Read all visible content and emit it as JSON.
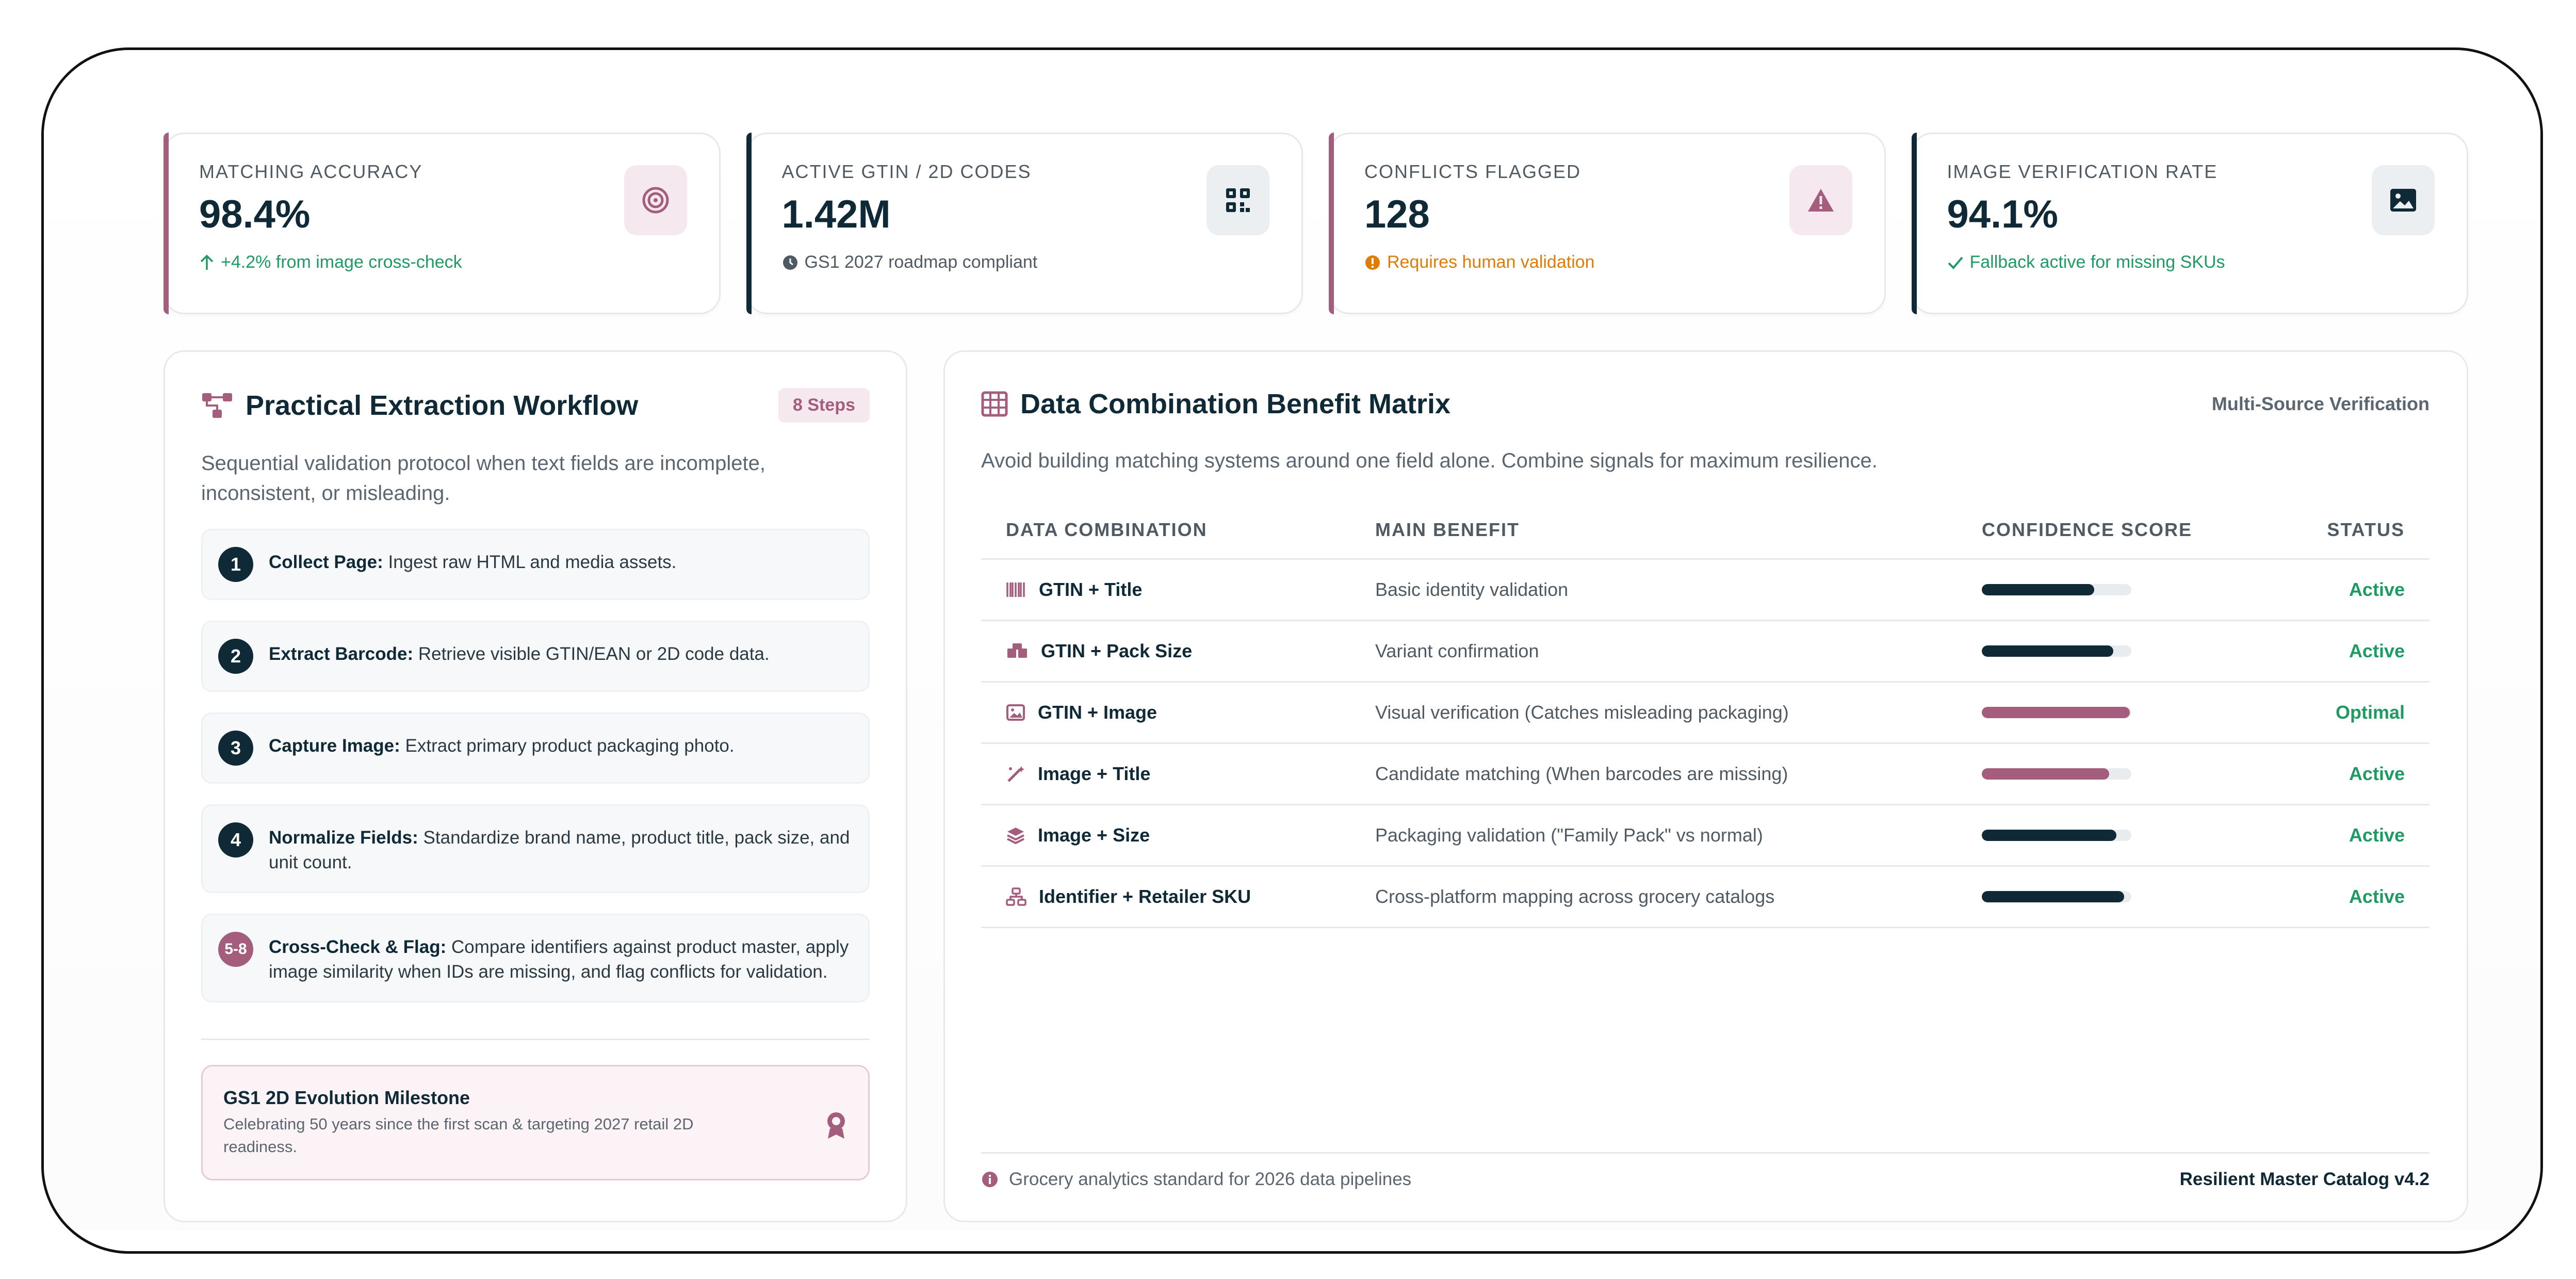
{
  "kpis": [
    {
      "label": "MATCHING ACCURACY",
      "value": "98.4%",
      "sub": "+4.2% from image cross-check",
      "sub_icon": "arrow-up-icon",
      "icon": "target-icon",
      "accent": "#a45d7c"
    },
    {
      "label": "ACTIVE GTIN / 2D CODES",
      "value": "1.42M",
      "sub": "GS1 2027 roadmap compliant",
      "sub_icon": "clock-icon",
      "icon": "qr-code-icon",
      "accent": "#0f2a36"
    },
    {
      "label": "CONFLICTS FLAGGED",
      "value": "128",
      "sub": "Requires human validation",
      "sub_icon": "alert-circle-icon",
      "icon": "warning-triangle-icon",
      "accent": "#a45d7c"
    },
    {
      "label": "IMAGE VERIFICATION RATE",
      "value": "94.1%",
      "sub": "Fallback active for missing SKUs",
      "sub_icon": "check-icon",
      "icon": "image-icon",
      "accent": "#0f2a36"
    }
  ],
  "workflow": {
    "title": "Practical Extraction Workflow",
    "badge": "8 Steps",
    "description": "Sequential validation protocol when text fields are incomplete, inconsistent, or misleading.",
    "steps": [
      {
        "num": "1",
        "title": "Collect Page:",
        "text": "Ingest raw HTML and media assets."
      },
      {
        "num": "2",
        "title": "Extract Barcode:",
        "text": "Retrieve visible GTIN/EAN or 2D code data."
      },
      {
        "num": "3",
        "title": "Capture Image:",
        "text": "Extract primary product packaging photo."
      },
      {
        "num": "4",
        "title": "Normalize Fields:",
        "text": "Standardize brand name, product title, pack size, and unit count."
      },
      {
        "num": "5-8",
        "title": "Cross-Check & Flag:",
        "text": "Compare identifiers against product master, apply image similarity when IDs are missing, and flag conflicts for validation."
      }
    ],
    "milestone": {
      "title": "GS1 2D Evolution Milestone",
      "text": "Celebrating 50 years since the first scan & targeting 2027 retail 2D readiness."
    }
  },
  "matrix": {
    "title": "Data Combination Benefit Matrix",
    "tag": "Multi-Source Verification",
    "description": "Avoid building matching systems around one field alone. Combine signals for maximum resilience.",
    "columns": [
      "DATA COMBINATION",
      "MAIN BENEFIT",
      "CONFIDENCE SCORE",
      "STATUS"
    ],
    "rows": [
      {
        "combo": "GTIN + Title",
        "icon": "barcode-icon",
        "benefit": "Basic identity validation",
        "score": 0.75,
        "bar_color": "#0f2a36",
        "status": "Active"
      },
      {
        "combo": "GTIN + Pack Size",
        "icon": "boxes-icon",
        "benefit": "Variant confirmation",
        "score": 0.88,
        "bar_color": "#0f2a36",
        "status": "Active"
      },
      {
        "combo": "GTIN + Image",
        "icon": "image-icon",
        "benefit": "Visual verification (Catches misleading packaging)",
        "score": 0.99,
        "bar_color": "#a45d7c",
        "status": "Optimal"
      },
      {
        "combo": "Image + Title",
        "icon": "magic-wand-icon",
        "benefit": "Candidate matching (When barcodes are missing)",
        "score": 0.85,
        "bar_color": "#a45d7c",
        "status": "Active"
      },
      {
        "combo": "Image + Size",
        "icon": "layers-icon",
        "benefit": "Packaging validation (\"Family Pack\" vs normal)",
        "score": 0.9,
        "bar_color": "#0f2a36",
        "status": "Active"
      },
      {
        "combo": "Identifier + Retailer SKU",
        "icon": "sitemap-icon",
        "benefit": "Cross-platform mapping across grocery catalogs",
        "score": 0.95,
        "bar_color": "#0f2a36",
        "status": "Active"
      }
    ],
    "footer_note": "Grocery analytics standard for 2026 data pipelines",
    "footer_version": "Resilient Master Catalog v4.2"
  }
}
